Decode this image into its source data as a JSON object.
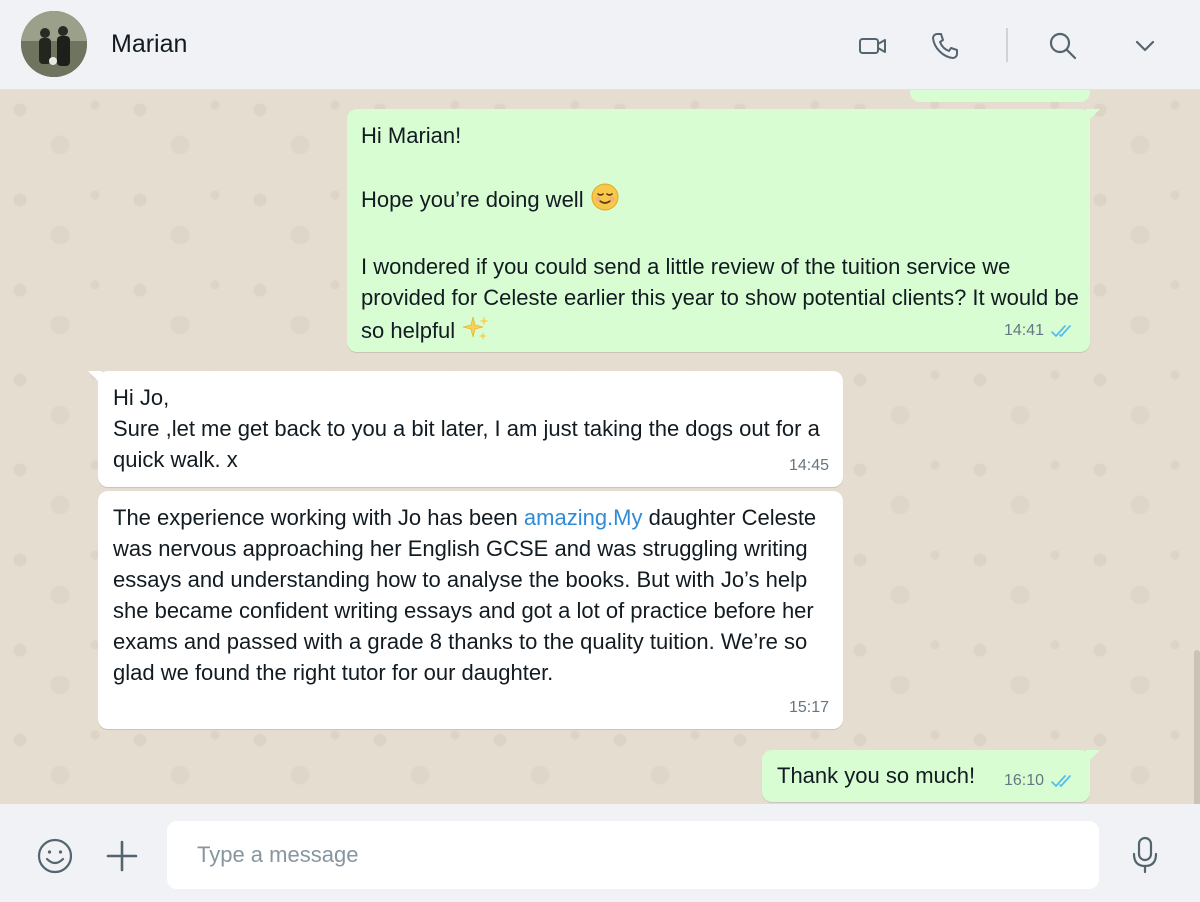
{
  "header": {
    "contact_name": "Marian"
  },
  "messages": [
    {
      "id": "m1",
      "direction": "out",
      "lines": [
        "Hi Marian!",
        "",
        "Hope you’re doing well"
      ],
      "emoji_1": "relieved-face",
      "body_2": "I wondered if you could send a little review of the tuition service we provided for Celeste earlier this year to show potential clients? It would be so helpful",
      "emoji_2": "sparkles",
      "time": "14:41",
      "status": "read"
    },
    {
      "id": "m2",
      "direction": "in",
      "text": "Hi Jo,\nSure ,let me get back to you a bit later, I am just taking the dogs out for a quick walk. x",
      "time": "14:45"
    },
    {
      "id": "m3",
      "direction": "in",
      "text_before_link": "The experience working with Jo has been ",
      "link_text": "amazing.My",
      "text_after_link": " daughter Celeste was nervous approaching her English GCSE and was struggling writing essays and understanding how to analyse the books. But with Jo’s help she became confident writing essays and got a lot of practice before her exams and passed with a grade 8 thanks to the quality tuition. We’re so glad we found the right tutor for our daughter.",
      "time": "15:17"
    },
    {
      "id": "m4",
      "direction": "out",
      "text": "Thank you so much!",
      "time": "16:10",
      "status": "read"
    }
  ],
  "composer": {
    "placeholder": "Type a message"
  },
  "colors": {
    "outgoing_bubble": "#d9fdd3",
    "incoming_bubble": "#ffffff",
    "read_ticks": "#53bdeb",
    "link": "#2f8bd8"
  },
  "icons": [
    "video-call-icon",
    "voice-call-icon",
    "search-icon",
    "chevron-down-icon",
    "emoji-icon",
    "attach-plus-icon",
    "microphone-icon",
    "read-ticks-icon"
  ]
}
